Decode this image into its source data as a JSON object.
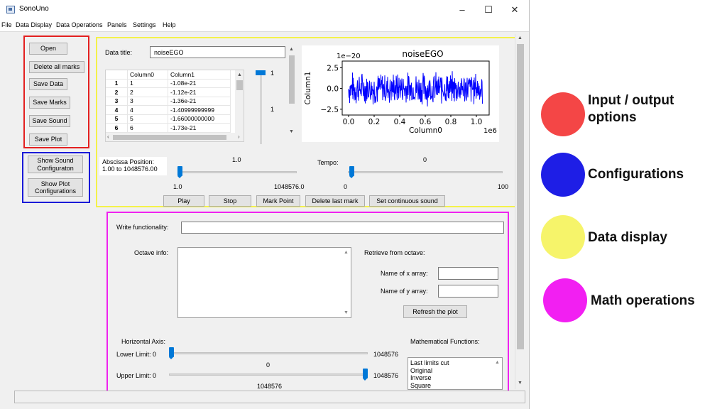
{
  "window": {
    "title": "SonoUno",
    "controls": {
      "minimize": "–",
      "maximize": "☐",
      "close": "✕"
    }
  },
  "menubar": [
    "File",
    "Data Display",
    "Data Operations",
    "Panels",
    "Settings",
    "Help"
  ],
  "io_buttons": [
    "Open",
    "Delete all marks",
    "Save Data",
    "Save Marks",
    "Save Sound",
    "Save Plot"
  ],
  "config_buttons": [
    "Show Sound Configuraton",
    "Show Plot Configurations"
  ],
  "data_display": {
    "data_title_label": "Data title:",
    "data_title_value": "noiseEGO",
    "table": {
      "headers": [
        "",
        "Column0",
        "Column1"
      ],
      "rows": [
        [
          "1",
          "1",
          "-1.08e-21"
        ],
        [
          "2",
          "2",
          "-1.12e-21"
        ],
        [
          "3",
          "3",
          "-1.36e-21"
        ],
        [
          "4",
          "4",
          "-1.40999999999"
        ],
        [
          "5",
          "5",
          "-1.66000000000"
        ],
        [
          "6",
          "6",
          "-1.73e-21"
        ]
      ]
    },
    "vslider_top": "1",
    "vslider_mid": "1",
    "abscissa_label": "Abscissa Position:",
    "abscissa_range": "1.00 to 1048576.00",
    "abscissa_value": "1.0",
    "abscissa_min": "1.0",
    "abscissa_max": "1048576.0",
    "tempo_label": "Tempo:",
    "tempo_value": "0",
    "tempo_min": "0",
    "tempo_max": "100",
    "actions": [
      "Play",
      "Stop",
      "Mark Point",
      "Delete last mark",
      "Set continuous sound"
    ]
  },
  "chart_data": {
    "type": "line",
    "title": "noiseEGO",
    "xlabel": "Column0",
    "ylabel": "Column1",
    "x_offset_label": "1e6",
    "y_offset_label": "1e−20",
    "xlim": [
      -0.05,
      1.1
    ],
    "ylim": [
      -3.2,
      3.3
    ],
    "xticks": [
      "0.0",
      "0.2",
      "0.4",
      "0.6",
      "0.8",
      "1.0"
    ],
    "xtick_values": [
      0.0,
      0.2,
      0.4,
      0.6,
      0.8,
      1.0
    ],
    "yticks": [
      "2.5",
      "0.0",
      "−2.5"
    ],
    "ytick_values": [
      2.5,
      0.0,
      -2.5
    ],
    "series": [
      {
        "x_range": [
          0.0,
          1.048576
        ],
        "y_envelope": [
          -2.2,
          2.2
        ],
        "color": "#0000ff"
      }
    ]
  },
  "math": {
    "write_label": "Write functionality:",
    "write_value": "",
    "octave_label": "Octave info:",
    "retrieve_label": "Retrieve from octave:",
    "x_array_label": "Name of x array:",
    "y_array_label": "Name of y array:",
    "refresh_label": "Refresh the plot",
    "horizontal_axis_label": "Horizontal Axis:",
    "lower_label": "Lower Limit: 0",
    "lower_max": "1048576",
    "lower_value": "0",
    "upper_label": "Upper Limit: 0",
    "upper_max": "1048576",
    "upper_value": "1048576",
    "math_functions_label": "Mathematical Functions:",
    "functions": [
      "Last limits cut",
      "Original",
      "Inverse",
      "Square"
    ]
  },
  "legend": [
    {
      "label": "Input / output options",
      "color": "#f44646"
    },
    {
      "label": "Configurations",
      "color": "#1e1ee6"
    },
    {
      "label": "Data display",
      "color": "#f6f46a"
    },
    {
      "label": "Math operations",
      "color": "#f21ff2"
    }
  ]
}
